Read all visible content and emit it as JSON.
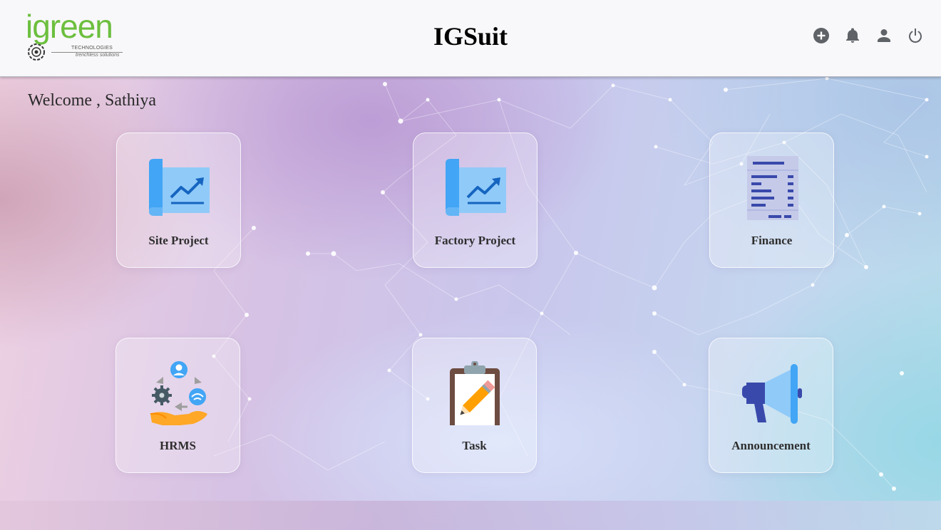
{
  "header": {
    "app_title": "IGSuit",
    "logo": {
      "word": "igreen",
      "sub": "TECHNOLOGIES",
      "tagline": "trenchless solutions"
    },
    "actions": [
      {
        "icon": "add-circle-icon"
      },
      {
        "icon": "bell-icon"
      },
      {
        "icon": "user-icon"
      },
      {
        "icon": "power-icon"
      }
    ]
  },
  "welcome": {
    "text": "Welcome , Sathiya"
  },
  "modules": [
    {
      "label": "Site Project",
      "icon": "blueprint-chart-icon"
    },
    {
      "label": "Factory Project",
      "icon": "blueprint-chart-icon"
    },
    {
      "label": "Finance",
      "icon": "invoice-document-icon"
    },
    {
      "label": "HRMS",
      "icon": "hr-cycle-hand-icon"
    },
    {
      "label": "Task",
      "icon": "clipboard-pencil-icon"
    },
    {
      "label": "Announcement",
      "icon": "megaphone-icon"
    }
  ],
  "colors": {
    "brand_green": "#6cbf3e",
    "header_bg": "#f8f8fa",
    "icon_gray": "#5f6368",
    "icon_blue": "#64b5f6"
  }
}
